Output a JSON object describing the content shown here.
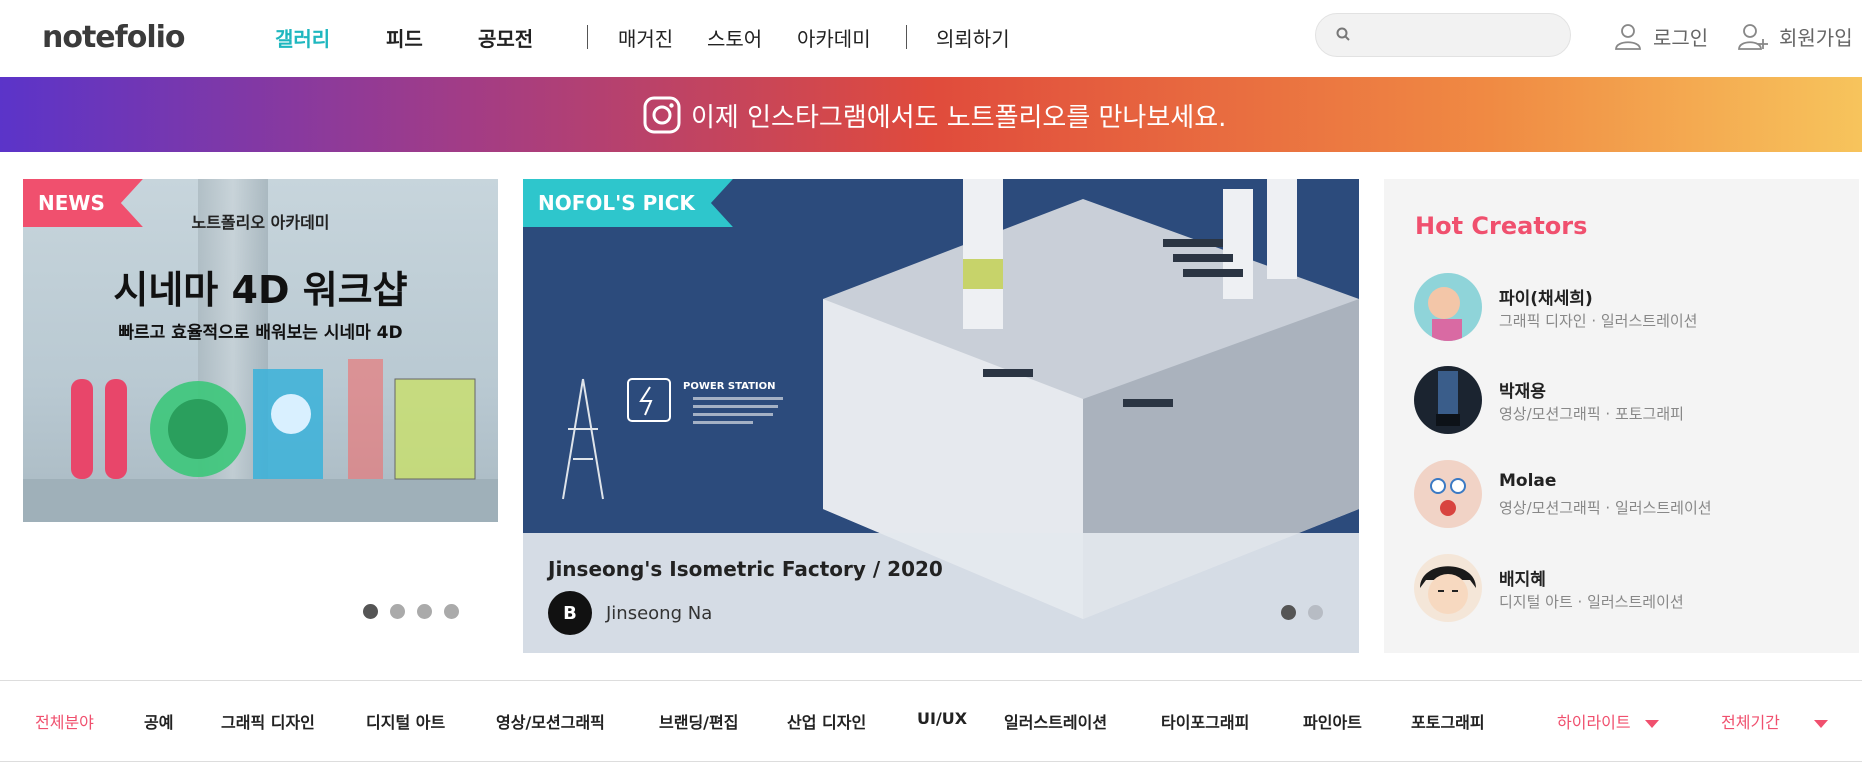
{
  "header": {
    "logo_text": "notefolio",
    "nav_primary": [
      "갤러리",
      "피드",
      "공모전"
    ],
    "nav_secondary": [
      "매거진",
      "스토어",
      "아카데미"
    ],
    "nav_request": "의뢰하기",
    "search_placeholder": "",
    "login_label": "로그인",
    "signup_label": "회원가입"
  },
  "banner": {
    "text": "이제 인스타그램에서도 노트폴리오를 만나보세요."
  },
  "news_card": {
    "tag": "NEWS",
    "ad_subtitle": "노트폴리오 아카데미",
    "ad_title": "시네마 4D 워크샵",
    "ad_description": "빠르고 효율적으로 배워보는 시네마 4D",
    "slide_count": 4,
    "active_slide": 1
  },
  "pick_card": {
    "tag": "NOFOL'S PICK",
    "title": "Jinseong's Isometric Factory / 2020",
    "author": "Jinseong Na",
    "artwork_label": "POWER STATION",
    "slide_count": 2,
    "active_slide": 1
  },
  "hot_creators": {
    "title": "Hot Creators",
    "items": [
      {
        "name": "파이(채세희)",
        "categories": "그래픽 디자인 · 일러스트레이션"
      },
      {
        "name": "박재용",
        "categories": "영상/모션그래픽 · 포토그래피"
      },
      {
        "name": "Molae",
        "categories": "영상/모션그래픽 · 일러스트레이션"
      },
      {
        "name": "배지혜",
        "categories": "디지털 아트 · 일러스트레이션"
      }
    ]
  },
  "category_bar": {
    "items": [
      "전체분야",
      "공예",
      "그래픽 디자인",
      "디지털 아트",
      "영상/모션그래픽",
      "브랜딩/편집",
      "산업 디자인",
      "UI/UX",
      "일러스트레이션",
      "타이포그래피",
      "파인아트",
      "포토그래피"
    ],
    "sort_label": "하이라이트",
    "period_label": "전체기간"
  },
  "colors": {
    "accent_teal": "#1fb7bf",
    "accent_pink": "#f0506e"
  }
}
